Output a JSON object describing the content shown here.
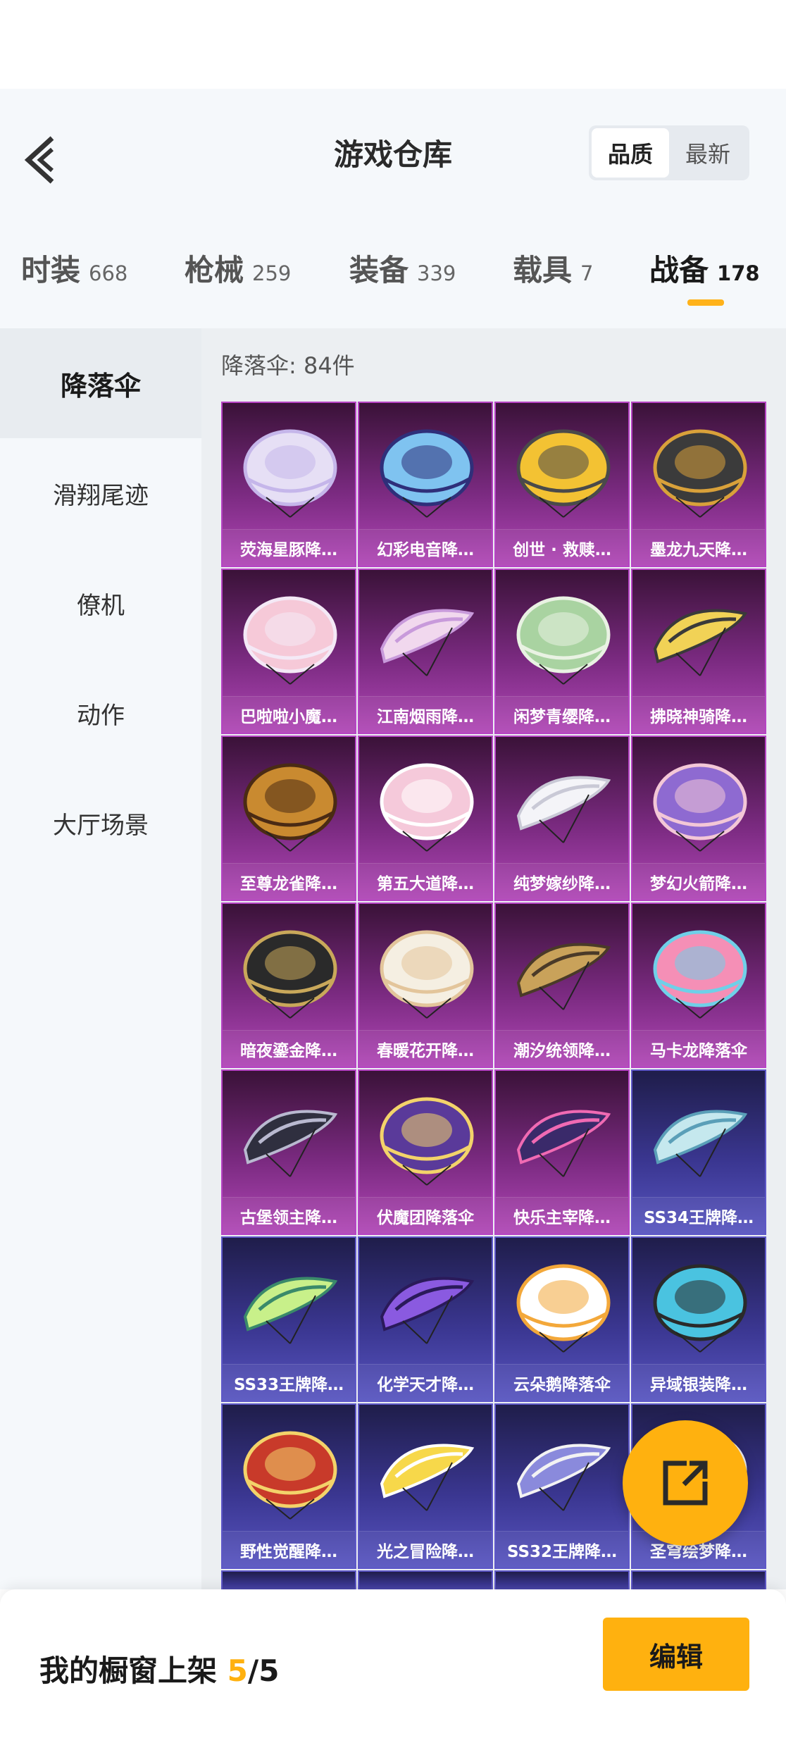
{
  "header": {
    "title": "游戏仓库",
    "sort_options": [
      {
        "label": "品质",
        "active": true
      },
      {
        "label": "最新",
        "active": false
      }
    ]
  },
  "tabs": [
    {
      "name": "时装",
      "count": "668"
    },
    {
      "name": "枪械",
      "count": "259"
    },
    {
      "name": "装备",
      "count": "339"
    },
    {
      "name": "载具",
      "count": "7"
    },
    {
      "name": "战备",
      "count": "178",
      "active": true
    }
  ],
  "sidebar": {
    "items": [
      {
        "label": "降落伞",
        "active": true
      },
      {
        "label": "滑翔尾迹"
      },
      {
        "label": "僚机"
      },
      {
        "label": "动作"
      },
      {
        "label": "大厅场景"
      }
    ]
  },
  "content": {
    "count_label": "降落伞: 84件",
    "items": [
      {
        "name": "荧海星豚降…",
        "tier": "purple",
        "icon": "parachute-dome",
        "colors": [
          "#e6dff5",
          "#c5b6ea"
        ]
      },
      {
        "name": "幻彩电音降…",
        "tier": "purple",
        "icon": "parachute-dome",
        "colors": [
          "#7fc3f0",
          "#2f2f7a"
        ]
      },
      {
        "name": "创世 · 救赎…",
        "tier": "purple",
        "icon": "parachute-dome",
        "colors": [
          "#f3c233",
          "#4a4a4a"
        ]
      },
      {
        "name": "墨龙九天降…",
        "tier": "purple",
        "icon": "parachute-dome",
        "colors": [
          "#3b3b3b",
          "#d9a13a"
        ]
      },
      {
        "name": "巴啦啦小魔…",
        "tier": "purple",
        "icon": "parachute-dome",
        "colors": [
          "#f6c9d8",
          "#f4e9f6"
        ]
      },
      {
        "name": "江南烟雨降…",
        "tier": "purple",
        "icon": "parachute-wing",
        "colors": [
          "#f1d8ee",
          "#c89adb"
        ]
      },
      {
        "name": "闲梦青缨降…",
        "tier": "purple",
        "icon": "parachute-dome",
        "colors": [
          "#a9d3a1",
          "#e9f2e3"
        ]
      },
      {
        "name": "拂晓神骑降…",
        "tier": "purple",
        "icon": "parachute-wing",
        "colors": [
          "#f1d256",
          "#3a3a3a"
        ]
      },
      {
        "name": "至尊龙雀降…",
        "tier": "purple",
        "icon": "parachute-dome",
        "colors": [
          "#c98a30",
          "#4a2b14"
        ]
      },
      {
        "name": "第五大道降…",
        "tier": "purple",
        "icon": "parachute-dome",
        "colors": [
          "#f5c9da",
          "#ffffff"
        ]
      },
      {
        "name": "纯梦嫁纱降…",
        "tier": "purple",
        "icon": "parachute-wing",
        "colors": [
          "#f4f4f8",
          "#c9c9d6"
        ]
      },
      {
        "name": "梦幻火箭降…",
        "tier": "purple",
        "icon": "parachute-dome",
        "colors": [
          "#8e6ad1",
          "#f3c7d7"
        ]
      },
      {
        "name": "暗夜鎏金降…",
        "tier": "purple",
        "icon": "parachute-dome",
        "colors": [
          "#2a2a2a",
          "#c9a85a"
        ]
      },
      {
        "name": "春暖花开降…",
        "tier": "purple",
        "icon": "parachute-dome",
        "colors": [
          "#f5efe2",
          "#e3c59b"
        ]
      },
      {
        "name": "潮汐统领降…",
        "tier": "purple",
        "icon": "parachute-wing",
        "colors": [
          "#c9a25a",
          "#4a3a28"
        ]
      },
      {
        "name": "马卡龙降落伞",
        "tier": "purple",
        "icon": "parachute-dome",
        "colors": [
          "#f58fb6",
          "#6fd0e8"
        ]
      },
      {
        "name": "古堡领主降…",
        "tier": "purple",
        "icon": "parachute-wing",
        "colors": [
          "#2f2f3f",
          "#b9b9d0"
        ]
      },
      {
        "name": "伏魔团降落伞",
        "tier": "purple",
        "icon": "parachute-dome",
        "colors": [
          "#5a3a9a",
          "#f3d36a"
        ]
      },
      {
        "name": "快乐主宰降…",
        "tier": "purple",
        "icon": "parachute-wing",
        "colors": [
          "#3a2a6a",
          "#f06ab3"
        ]
      },
      {
        "name": "SS34王牌降…",
        "tier": "blue",
        "icon": "parachute-wing",
        "colors": [
          "#c5e8ee",
          "#5a9fb8"
        ]
      },
      {
        "name": "SS33王牌降…",
        "tier": "blue",
        "icon": "parachute-wing",
        "colors": [
          "#c8f08a",
          "#3a8a6a"
        ]
      },
      {
        "name": "化学天才降…",
        "tier": "blue",
        "icon": "parachute-wing",
        "colors": [
          "#8a5ae0",
          "#2a1a5a"
        ]
      },
      {
        "name": "云朵鹅降落伞",
        "tier": "blue",
        "icon": "parachute-dome",
        "colors": [
          "#ffffff",
          "#f3a83a"
        ]
      },
      {
        "name": "异域银装降…",
        "tier": "blue",
        "icon": "parachute-dome",
        "colors": [
          "#4ac3e0",
          "#2a2a2a"
        ]
      },
      {
        "name": "野性觉醒降…",
        "tier": "blue",
        "icon": "parachute-dome",
        "colors": [
          "#c83a2a",
          "#f3d36a"
        ]
      },
      {
        "name": "光之冒险降…",
        "tier": "blue",
        "icon": "parachute-wing",
        "colors": [
          "#f7d84a",
          "#ffffff"
        ]
      },
      {
        "name": "SS32王牌降…",
        "tier": "blue",
        "icon": "parachute-wing",
        "colors": [
          "#8a8adc",
          "#f3f3f3"
        ]
      },
      {
        "name": "圣穹绘梦降…",
        "tier": "blue",
        "icon": "parachute-dome",
        "colors": [
          "#5aa0e0",
          "#f3f3f3"
        ]
      }
    ]
  },
  "footer": {
    "label_prefix": "我的橱窗上架 ",
    "shown": "5",
    "total": "/5",
    "edit_label": "编辑"
  },
  "colors": {
    "accent": "#ffb10f",
    "purple_tier": "#b046b6",
    "blue_tier": "#5754c0"
  }
}
